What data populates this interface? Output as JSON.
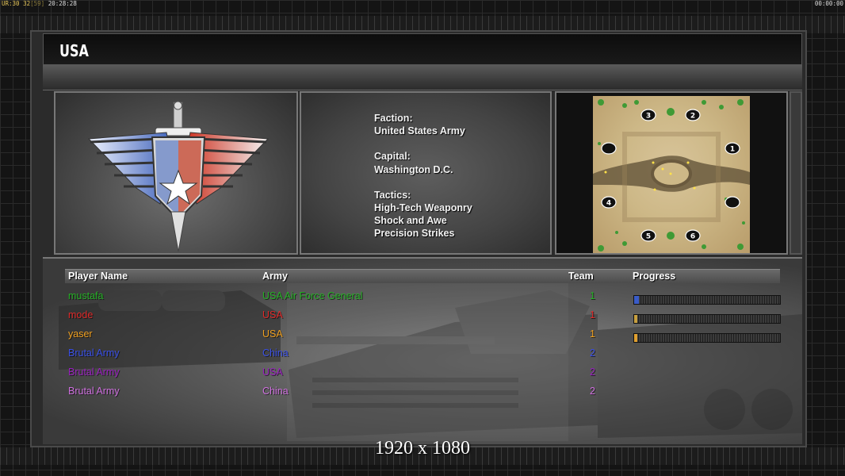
{
  "debug": {
    "left_segments": [
      {
        "text": "UR:30 32",
        "color": "#e6c65a"
      },
      {
        "text": "[59]",
        "color": "#8a7a3a"
      },
      {
        "text": " 20:28:28",
        "color": "#dddddd"
      }
    ],
    "right": "00:00:00"
  },
  "title": "USA",
  "info": {
    "faction_label": "Faction:",
    "faction_value": "United States Army",
    "capital_label": "Capital:",
    "capital_value": "Washington D.C.",
    "tactics_label": "Tactics:",
    "tactics": [
      "High-Tech Weaponry",
      "Shock and Awe",
      "Precision Strikes"
    ]
  },
  "map": {
    "start_positions": [
      "1",
      "2",
      "3",
      "4",
      "5",
      "6"
    ]
  },
  "players": {
    "headers": {
      "name": "Player Name",
      "army": "Army",
      "team": "Team",
      "progress": "Progress"
    },
    "rows": [
      {
        "name": "mustafa",
        "army": "USA Air Force General",
        "team": "1",
        "color": "#25b025",
        "progress": 0.03,
        "fill": "#3a5cc8"
      },
      {
        "name": "mode",
        "army": "USA",
        "team": "1",
        "color": "#e02a2a",
        "progress": 0.01,
        "fill": "#c8a040"
      },
      {
        "name": "yaser",
        "army": "USA",
        "team": "1",
        "color": "#f0a020",
        "progress": 0.01,
        "fill": "#e0a030"
      },
      {
        "name": "Brutal Army",
        "army": "China",
        "team": "2",
        "color": "#3a50e8",
        "progress": null,
        "fill": ""
      },
      {
        "name": "Brutal Army",
        "army": "USA",
        "team": "2",
        "color": "#9a20c0",
        "progress": null,
        "fill": ""
      },
      {
        "name": "Brutal Army",
        "army": "China",
        "team": "2",
        "color": "#d070e0",
        "progress": null,
        "fill": ""
      }
    ]
  },
  "resolution_text": "1920 x 1080"
}
